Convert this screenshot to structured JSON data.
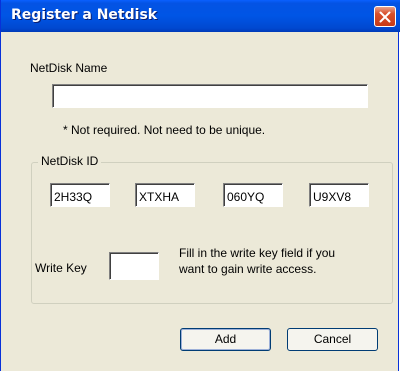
{
  "window": {
    "title": "Register a Netdisk"
  },
  "netdisk_name": {
    "label": "NetDisk Name",
    "value": "",
    "hint": "* Not required.  Not need to be unique."
  },
  "netdisk_id": {
    "group_label": "NetDisk ID",
    "fields": [
      "2H33Q",
      "XTXHA",
      "060YQ",
      "U9XV8"
    ]
  },
  "write_key": {
    "label": "Write Key",
    "value": "",
    "help_line1": "Fill in the write key field if you",
    "help_line2": "want to gain write access."
  },
  "buttons": {
    "add": "Add",
    "cancel": "Cancel"
  },
  "colors": {
    "titlebar": "#0055e5",
    "dialog_bg": "#ece9d8",
    "close_button": "#d9502c"
  },
  "icons": {
    "close": "close-icon"
  }
}
